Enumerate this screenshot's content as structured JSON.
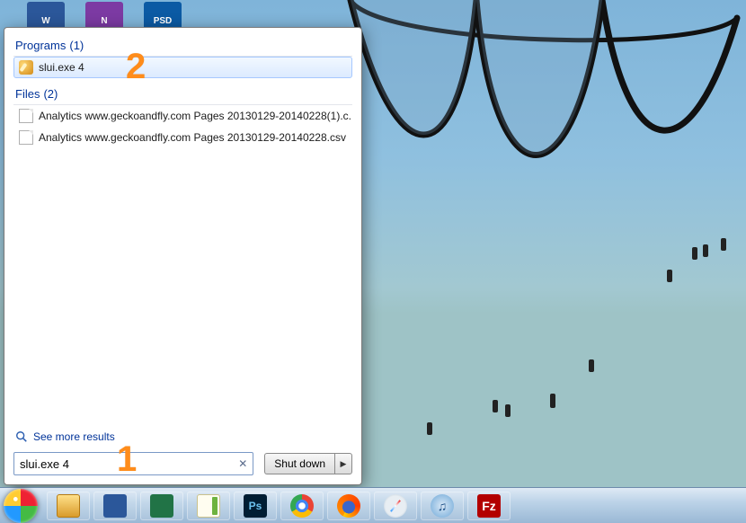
{
  "desktop_icons": [
    {
      "name": "word-shortcut",
      "label": "W"
    },
    {
      "name": "onenote-shortcut",
      "label": "N"
    },
    {
      "name": "psd-file",
      "label": "PSD"
    }
  ],
  "start_results": {
    "programs": {
      "header": "Programs",
      "count": "(1)",
      "items": [
        {
          "label": "slui.exe 4"
        }
      ]
    },
    "files": {
      "header": "Files",
      "count": "(2)",
      "items": [
        {
          "label": "Analytics www.geckoandfly.com Pages 20130129-20140228(1).c..."
        },
        {
          "label": "Analytics www.geckoandfly.com Pages 20130129-20140228.csv"
        }
      ]
    },
    "see_more": "See more results",
    "search_value": "slui.exe 4",
    "shutdown_label": "Shut down"
  },
  "annotations": {
    "one": "1",
    "two": "2"
  },
  "taskbar": {
    "items": [
      {
        "name": "explorer",
        "label": ""
      },
      {
        "name": "word",
        "label": ""
      },
      {
        "name": "excel",
        "label": ""
      },
      {
        "name": "notepadpp",
        "label": ""
      },
      {
        "name": "photoshop",
        "label": "Ps"
      },
      {
        "name": "chrome",
        "label": ""
      },
      {
        "name": "firefox",
        "label": ""
      },
      {
        "name": "safari",
        "label": ""
      },
      {
        "name": "itunes",
        "label": ""
      },
      {
        "name": "filezilla",
        "label": "Fz"
      }
    ]
  }
}
